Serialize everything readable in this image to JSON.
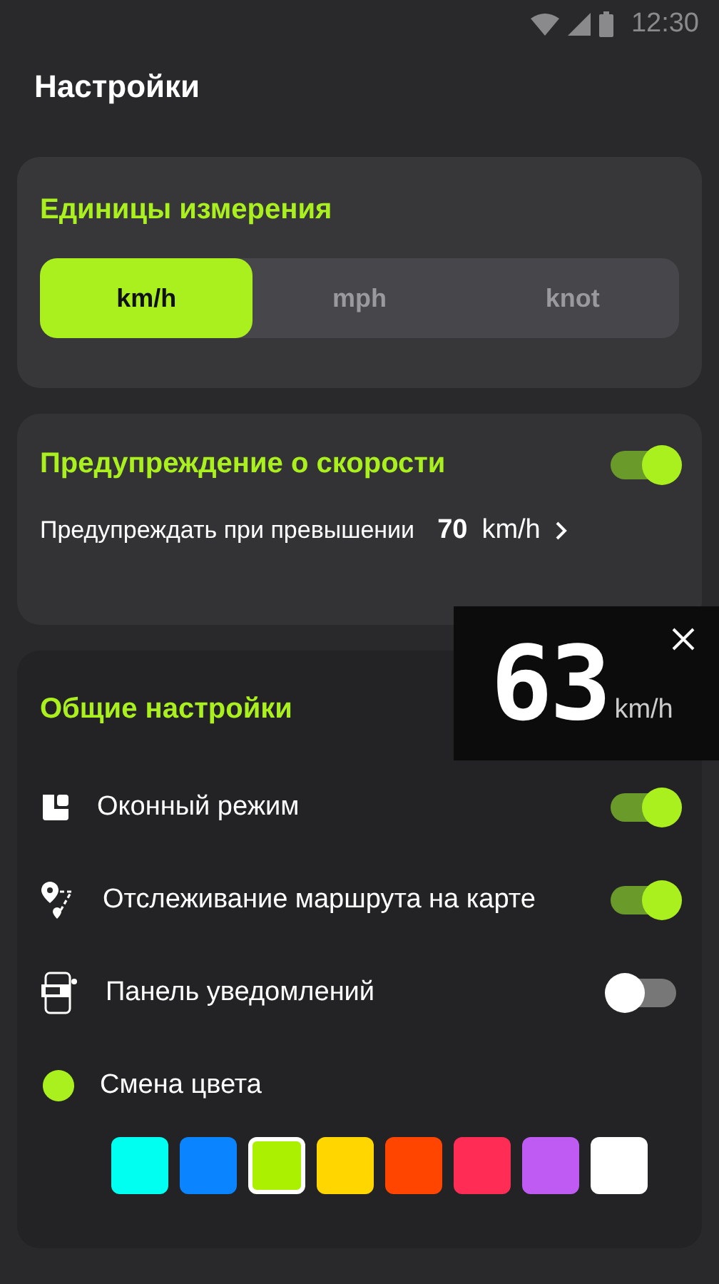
{
  "status_bar": {
    "time": "12:30"
  },
  "header": {
    "title": "Настройки"
  },
  "units": {
    "title": "Единицы измерения",
    "options": [
      {
        "label": "km/h",
        "selected": true
      },
      {
        "label": "mph",
        "selected": false
      },
      {
        "label": "knot",
        "selected": false
      }
    ]
  },
  "speed_warning": {
    "title": "Предупреждение о скорости",
    "on": true,
    "label": "Предупреждать при превышении",
    "value": "70",
    "unit": "km/h"
  },
  "general": {
    "title": "Общие настройки",
    "items": [
      {
        "kind": "toggle",
        "label": "Оконный режим",
        "on": true
      },
      {
        "kind": "toggle",
        "label": "Отслеживание маршрута на карте",
        "on": true
      },
      {
        "kind": "toggle",
        "label": "Панель уведомлений",
        "on": false
      },
      {
        "kind": "color",
        "label": "Смена цвета",
        "color": "#aaf01e"
      }
    ],
    "swatches": [
      {
        "color": "#00fff0",
        "selected": false
      },
      {
        "color": "#0a84ff",
        "selected": false
      },
      {
        "color": "#aaf000",
        "selected": true
      },
      {
        "color": "#ffd600",
        "selected": false
      },
      {
        "color": "#ff4500",
        "selected": false
      },
      {
        "color": "#ff2d55",
        "selected": false
      },
      {
        "color": "#bf5af2",
        "selected": false
      },
      {
        "color": "#ffffff",
        "selected": false
      }
    ]
  },
  "speedometer": {
    "speed": "63",
    "unit": "km/h"
  }
}
